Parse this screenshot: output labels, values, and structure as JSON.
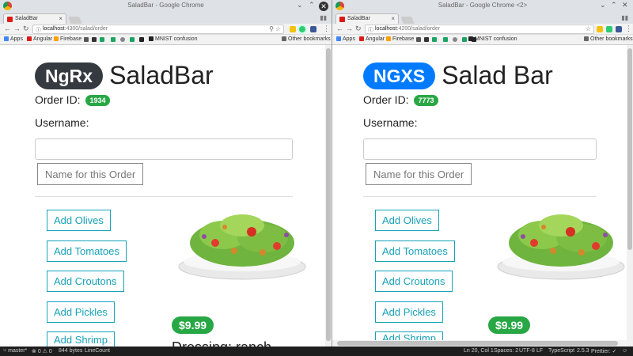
{
  "left": {
    "window_title": "SaladBar - Google Chrome",
    "tab_title": "SaladBar",
    "url_host": "localhost",
    "url_path": ":4300/salad/order",
    "bookmarks": [
      "Apps",
      "Angular",
      "Firebase",
      "MNIST confusion",
      "Other bookmarks"
    ],
    "badge": "NgRx",
    "badge_color": "#343a40",
    "app_title": "SaladBar",
    "order_label": "Order ID:",
    "order_id": "1934",
    "username_label": "Username:",
    "name_button": "Name for this Order",
    "add_buttons": [
      "Add Olives",
      "Add Tomatoes",
      "Add Croutons",
      "Add Pickles",
      "Add Shrimp"
    ],
    "price": "$9.99",
    "dressing": "Dressing: ranch"
  },
  "right": {
    "window_title": "SaladBar - Google Chrome <2>",
    "tab_title": "SaladBar",
    "url_host": "localhost",
    "url_path": ":4200/salad/order",
    "bookmarks": [
      "Apps",
      "Angular",
      "Firebase",
      "MNIST confusion",
      "Other bookmarks"
    ],
    "badge": "NGXS",
    "badge_color": "#007bff",
    "app_title": "Salad Bar",
    "order_label": "Order ID:",
    "order_id": "7773",
    "username_label": "Username:",
    "name_button": "Name for this Order",
    "add_buttons": [
      "Add Olives",
      "Add Tomatoes",
      "Add Croutons",
      "Add Pickles",
      "Add Shrimp"
    ],
    "price": "$9.99"
  },
  "statusbar": {
    "branch": "master*",
    "errors": "0",
    "warnings": "0",
    "size": "844 bytes",
    "linecount": "LineCount",
    "position": "Ln 20, Col 1",
    "spaces": "Spaces: 2",
    "encoding": "UTF-8",
    "eol": "LF",
    "language": "TypeScript",
    "version": "2.5.3",
    "prettier": "Prettier: ✓"
  },
  "colors": {
    "accent_teal": "#17a2b8",
    "success_green": "#28a745"
  }
}
